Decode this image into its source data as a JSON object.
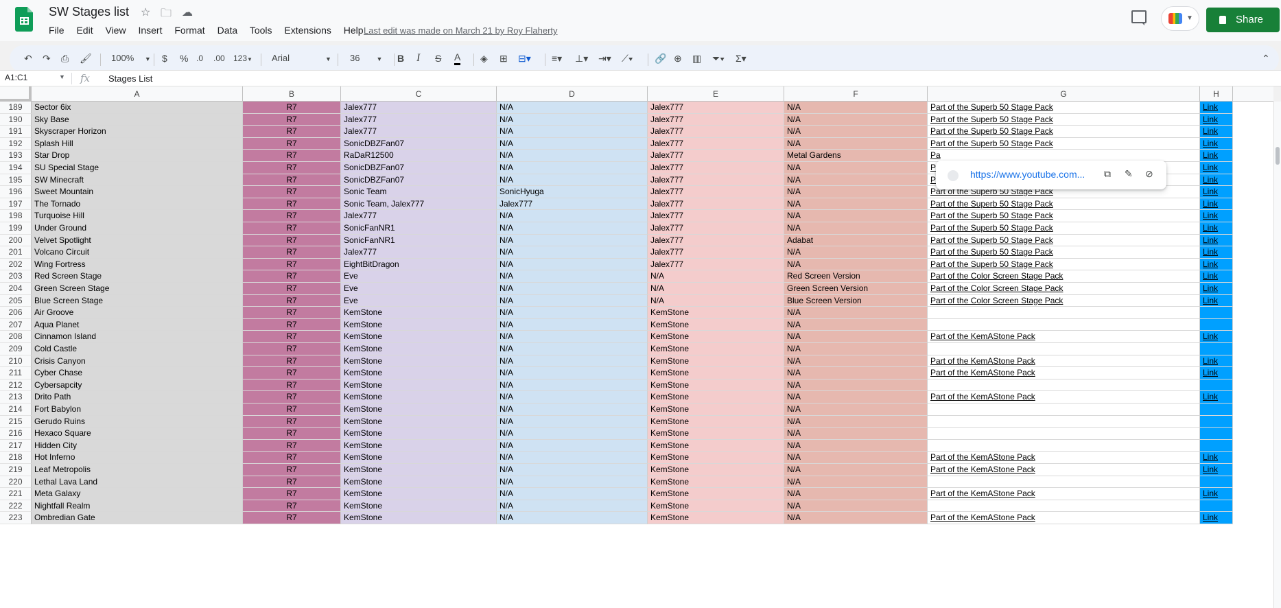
{
  "app": {
    "doc_title": "SW Stages list",
    "menu": [
      "File",
      "Edit",
      "View",
      "Insert",
      "Format",
      "Data",
      "Tools",
      "Extensions",
      "Help"
    ],
    "last_edit": "Last edit was made on March 21 by Roy Flaherty",
    "share_label": "Share",
    "brand_color": "#0f9d58",
    "share_color": "#188038"
  },
  "toolbar": {
    "zoom": "100%",
    "currency": "$",
    "percent": "%",
    "dec_decrease": ".0",
    "dec_increase": ".00",
    "number_format": "123",
    "font": "Arial",
    "font_size": "36"
  },
  "formula_bar": {
    "name_box": "A1:C1",
    "fx": "fx",
    "value": "Stages List"
  },
  "columns": [
    "A",
    "B",
    "C",
    "D",
    "E",
    "F",
    "G",
    "H"
  ],
  "column_colors": {
    "A": "#d9d9d9",
    "B": "#c27ba0",
    "C": "#d9d2e9",
    "D": "#cfe2f3",
    "E": "#f4cccc",
    "F": "#e6b8af",
    "G": "#ffffff",
    "H": "#00a0ff"
  },
  "rows": [
    {
      "n": "189",
      "a": "Sector 6ix",
      "b": "R7",
      "c": "Jalex777",
      "d": "N/A",
      "e": "Jalex777",
      "f": "N/A",
      "g": "Part of the Superb 50 Stage Pack",
      "h": "Link"
    },
    {
      "n": "190",
      "a": "Sky Base",
      "b": "R7",
      "c": "Jalex777",
      "d": "N/A",
      "e": "Jalex777",
      "f": "N/A",
      "g": "Part of the Superb 50 Stage Pack",
      "h": "Link"
    },
    {
      "n": "191",
      "a": "Skyscraper Horizon",
      "b": "R7",
      "c": "Jalex777",
      "d": "N/A",
      "e": "Jalex777",
      "f": "N/A",
      "g": "Part of the Superb 50 Stage Pack",
      "h": "Link"
    },
    {
      "n": "192",
      "a": "Splash Hill",
      "b": "R7",
      "c": "SonicDBZFan07",
      "d": "N/A",
      "e": "Jalex777",
      "f": "N/A",
      "g": "Part of the Superb 50 Stage Pack",
      "h": "Link"
    },
    {
      "n": "193",
      "a": "Star Drop",
      "b": "R7",
      "c": "RaDaR12500",
      "d": "N/A",
      "e": "Jalex777",
      "f": "Metal Gardens",
      "g": "Pa",
      "h": "Link"
    },
    {
      "n": "194",
      "a": "SU Special Stage",
      "b": "R7",
      "c": "SonicDBZFan07",
      "d": "N/A",
      "e": "Jalex777",
      "f": "N/A",
      "g": "Pa",
      "h": "Link"
    },
    {
      "n": "195",
      "a": "SW Minecraft",
      "b": "R7",
      "c": "SonicDBZFan07",
      "d": "N/A",
      "e": "Jalex777",
      "f": "N/A",
      "g": "Part of the Superb 50 Stage Pack",
      "h": "Link"
    },
    {
      "n": "196",
      "a": "Sweet Mountain",
      "b": "R7",
      "c": "Sonic Team",
      "d": "SonicHyuga",
      "e": "Jalex777",
      "f": "N/A",
      "g": "Part of the Superb 50 Stage Pack",
      "h": "Link"
    },
    {
      "n": "197",
      "a": "The Tornado",
      "b": "R7",
      "c": "Sonic Team, Jalex777",
      "d": "Jalex777",
      "e": "Jalex777",
      "f": "N/A",
      "g": "Part of the Superb 50 Stage Pack",
      "h": "Link"
    },
    {
      "n": "198",
      "a": "Turquoise Hill",
      "b": "R7",
      "c": "Jalex777",
      "d": "N/A",
      "e": "Jalex777",
      "f": "N/A",
      "g": "Part of the Superb 50 Stage Pack",
      "h": "Link"
    },
    {
      "n": "199",
      "a": "Under Ground",
      "b": "R7",
      "c": "SonicFanNR1",
      "d": "N/A",
      "e": "Jalex777",
      "f": "N/A",
      "g": "Part of the Superb 50 Stage Pack",
      "h": "Link"
    },
    {
      "n": "200",
      "a": "Velvet Spotlight",
      "b": "R7",
      "c": "SonicFanNR1",
      "d": "N/A",
      "e": "Jalex777",
      "f": "Adabat",
      "g": "Part of the Superb 50 Stage Pack",
      "h": "Link"
    },
    {
      "n": "201",
      "a": "Volcano Circuit",
      "b": "R7",
      "c": "Jalex777",
      "d": "N/A",
      "e": "Jalex777",
      "f": "N/A",
      "g": "Part of the Superb 50 Stage Pack",
      "h": "Link"
    },
    {
      "n": "202",
      "a": "Wing Fortress",
      "b": "R7",
      "c": "EightBitDragon",
      "d": "N/A",
      "e": "Jalex777",
      "f": "N/A",
      "g": "Part of the Superb 50 Stage Pack",
      "h": "Link"
    },
    {
      "n": "203",
      "a": "Red Screen Stage",
      "b": "R7",
      "c": "Eve",
      "d": "N/A",
      "e": "N/A",
      "f": "Red Screen Version",
      "g": "Part of the Color Screen Stage Pack",
      "h": "Link"
    },
    {
      "n": "204",
      "a": "Green Screen Stage",
      "b": "R7",
      "c": "Eve",
      "d": "N/A",
      "e": "N/A",
      "f": "Green Screen Version",
      "g": "Part of the Color Screen Stage Pack",
      "h": "Link"
    },
    {
      "n": "205",
      "a": "Blue Screen Stage",
      "b": "R7",
      "c": "Eve",
      "d": "N/A",
      "e": "N/A",
      "f": "Blue Screen Version",
      "g": "Part of the Color Screen Stage Pack",
      "h": "Link"
    },
    {
      "n": "206",
      "a": "Air Groove",
      "b": "R7",
      "c": "KemStone",
      "d": "N/A",
      "e": "KemStone",
      "f": "N/A",
      "g": "",
      "h": ""
    },
    {
      "n": "207",
      "a": "Aqua Planet",
      "b": "R7",
      "c": "KemStone",
      "d": "N/A",
      "e": "KemStone",
      "f": "N/A",
      "g": "",
      "h": ""
    },
    {
      "n": "208",
      "a": "Cinnamon Island",
      "b": "R7",
      "c": "KemStone",
      "d": "N/A",
      "e": "KemStone",
      "f": "N/A",
      "g": "Part of the KemAStone Pack",
      "h": "Link"
    },
    {
      "n": "209",
      "a": "Cold Castle",
      "b": "R7",
      "c": "KemStone",
      "d": "N/A",
      "e": "KemStone",
      "f": "N/A",
      "g": "",
      "h": ""
    },
    {
      "n": "210",
      "a": "Crisis Canyon",
      "b": "R7",
      "c": "KemStone",
      "d": "N/A",
      "e": "KemStone",
      "f": "N/A",
      "g": "Part of the KemAStone Pack",
      "h": "Link"
    },
    {
      "n": "211",
      "a": "Cyber Chase",
      "b": "R7",
      "c": "KemStone",
      "d": "N/A",
      "e": "KemStone",
      "f": "N/A",
      "g": "Part of the KemAStone Pack",
      "h": "Link"
    },
    {
      "n": "212",
      "a": "Cybersapcity",
      "b": "R7",
      "c": "KemStone",
      "d": "N/A",
      "e": "KemStone",
      "f": "N/A",
      "g": "",
      "h": ""
    },
    {
      "n": "213",
      "a": "Drito Path",
      "b": "R7",
      "c": "KemStone",
      "d": "N/A",
      "e": "KemStone",
      "f": "N/A",
      "g": "Part of the KemAStone Pack",
      "h": "Link"
    },
    {
      "n": "214",
      "a": "Fort Babylon",
      "b": "R7",
      "c": "KemStone",
      "d": "N/A",
      "e": "KemStone",
      "f": "N/A",
      "g": "",
      "h": ""
    },
    {
      "n": "215",
      "a": "Gerudo Ruins",
      "b": "R7",
      "c": "KemStone",
      "d": "N/A",
      "e": "KemStone",
      "f": "N/A",
      "g": "",
      "h": ""
    },
    {
      "n": "216",
      "a": "Hexaco Square",
      "b": "R7",
      "c": "KemStone",
      "d": "N/A",
      "e": "KemStone",
      "f": "N/A",
      "g": "",
      "h": ""
    },
    {
      "n": "217",
      "a": "Hidden City",
      "b": "R7",
      "c": "KemStone",
      "d": "N/A",
      "e": "KemStone",
      "f": "N/A",
      "g": "",
      "h": ""
    },
    {
      "n": "218",
      "a": "Hot Inferno",
      "b": "R7",
      "c": "KemStone",
      "d": "N/A",
      "e": "KemStone",
      "f": "N/A",
      "g": "Part of the KemAStone Pack",
      "h": "Link"
    },
    {
      "n": "219",
      "a": "Leaf Metropolis",
      "b": "R7",
      "c": "KemStone",
      "d": "N/A",
      "e": "KemStone",
      "f": "N/A",
      "g": "Part of the KemAStone Pack",
      "h": "Link"
    },
    {
      "n": "220",
      "a": "Lethal Lava Land",
      "b": "R7",
      "c": "KemStone",
      "d": "N/A",
      "e": "KemStone",
      "f": "N/A",
      "g": "",
      "h": ""
    },
    {
      "n": "221",
      "a": "Meta Galaxy",
      "b": "R7",
      "c": "KemStone",
      "d": "N/A",
      "e": "KemStone",
      "f": "N/A",
      "g": "Part of the KemAStone Pack",
      "h": "Link"
    },
    {
      "n": "222",
      "a": "Nightfall Realm",
      "b": "R7",
      "c": "KemStone",
      "d": "N/A",
      "e": "KemStone",
      "f": "N/A",
      "g": "",
      "h": ""
    },
    {
      "n": "223",
      "a": "Ombredian Gate",
      "b": "R7",
      "c": "KemStone",
      "d": "N/A",
      "e": "KemStone",
      "f": "N/A",
      "g": "Part of the KemAStone Pack",
      "h": "Link"
    }
  ],
  "link_popup": {
    "url": "https://www.youtube.com...",
    "icons": [
      "copy-icon",
      "edit-icon",
      "unlink-icon"
    ]
  },
  "icons": [
    "star-icon",
    "move-folder-icon",
    "cloud-status-icon",
    "comments-icon",
    "meet-icon",
    "lock-icon",
    "undo-icon",
    "redo-icon",
    "print-icon",
    "paint-format-icon"
  ]
}
